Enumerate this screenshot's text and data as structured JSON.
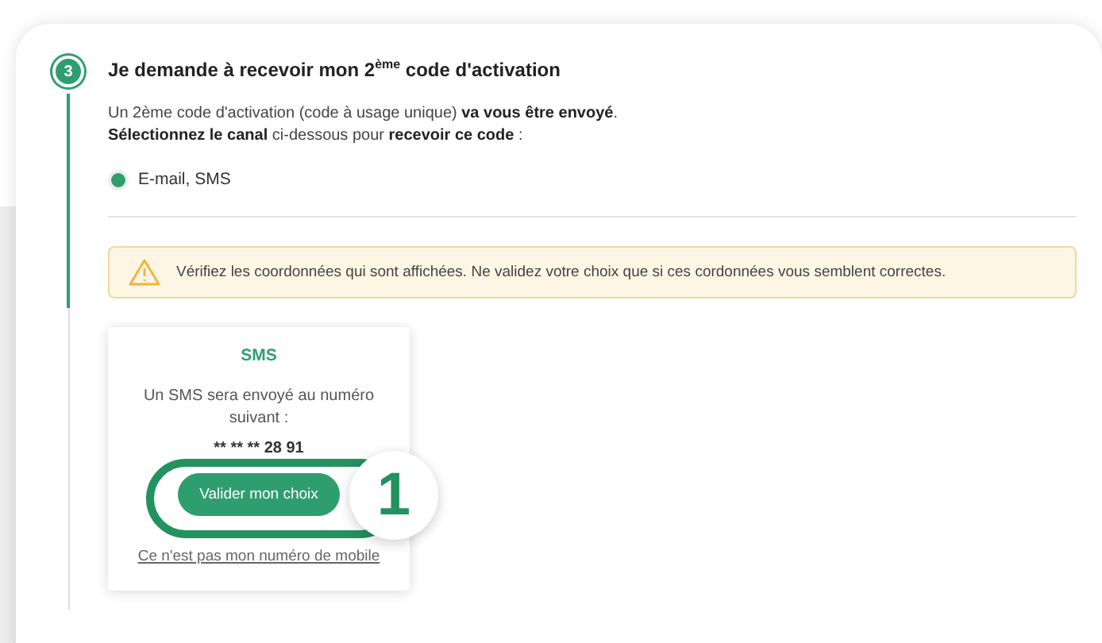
{
  "step": {
    "number": "3",
    "title": "Je demande à recevoir mon 2$^{ème}$ code d'activation"
  },
  "intro": [
    "Un 2ème code d'activation (code à usage unique) **va vous être envoyé**.",
    "**Sélectionnez le canal** ci-dessous pour **recevoir ce code** :"
  ],
  "channels": [
    {
      "label": "E-mail, SMS",
      "selected": true
    }
  ],
  "warning": {
    "text": "Vérifiez les coordonnées qui sont affichées. Ne validez votre choix que si ces cordonnées vous semblent correctes."
  },
  "sms_card": {
    "title": "SMS",
    "text": "Un SMS sera envoyé au numéro suivant :",
    "number": "** ** ** 28 91",
    "button": "Valider mon choix",
    "link": "Ce n'est pas mon numéro de mobile"
  },
  "callout": {
    "number": "1"
  }
}
